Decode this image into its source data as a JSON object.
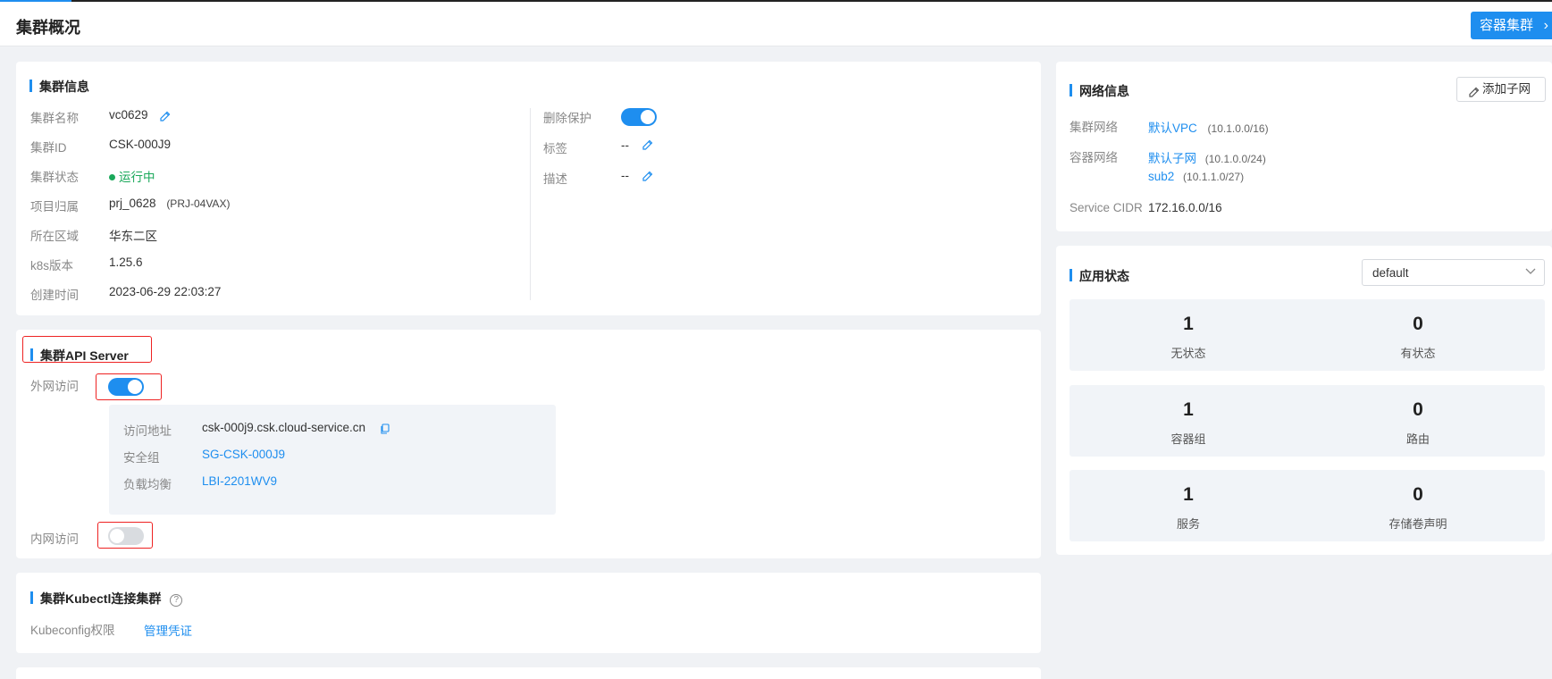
{
  "header": {
    "title": "集群概况",
    "container_cluster_btn": "容器集群",
    "chevron": "›"
  },
  "cluster_info": {
    "title": "集群信息",
    "left": [
      {
        "label": "集群名称",
        "value": "vc0629"
      },
      {
        "label": "集群ID",
        "value": "CSK-000J9"
      },
      {
        "label": "集群状态",
        "value": "运行中"
      },
      {
        "label": "项目归属",
        "value": "prj_0628",
        "extra": "(PRJ-04VAX)"
      },
      {
        "label": "所在区域",
        "value": "华东二区"
      },
      {
        "label": "k8s版本",
        "value": "1.25.6"
      },
      {
        "label": "创建时间",
        "value": "2023-06-29 22:03:27"
      }
    ],
    "right": [
      {
        "label": "删除保护",
        "value": ""
      },
      {
        "label": "标签",
        "value": "--"
      },
      {
        "label": "描述",
        "value": "--"
      }
    ],
    "delete_protection_on": true
  },
  "api_server": {
    "title": "集群API Server",
    "public_label": "外网访问",
    "public_on": true,
    "details": [
      {
        "label": "访问地址",
        "value": "csk-000j9.csk.cloud-service.cn"
      },
      {
        "label": "安全组",
        "value": "SG-CSK-000J9"
      },
      {
        "label": "负载均衡",
        "value": "LBI-2201WV9"
      }
    ],
    "private_label": "内网访问",
    "private_on": false
  },
  "kubectl": {
    "title": "集群Kubectl连接集群",
    "help_icon": "?",
    "kubeconfig_label": "Kubeconfig权限",
    "kubeconfig_link": "管理凭证"
  },
  "network": {
    "title": "网络信息",
    "add_subnet_btn": "添加子网",
    "cluster_net_label": "集群网络",
    "cluster_net_link": "默认VPC",
    "cluster_net_cidr": "(10.1.0.0/16)",
    "container_net_label": "容器网络",
    "container_nets": [
      {
        "name": "默认子网",
        "cidr": "(10.1.0.0/24)"
      },
      {
        "name": "sub2",
        "cidr": "(10.1.1.0/27)"
      }
    ],
    "service_cidr_label": "Service CIDR",
    "service_cidr_value": "172.16.0.0/16"
  },
  "app_status": {
    "title": "应用状态",
    "namespace_selected": "default",
    "stats": [
      {
        "num": "1",
        "label": "无状态"
      },
      {
        "num": "0",
        "label": "有状态"
      },
      {
        "num": "1",
        "label": "容器组"
      },
      {
        "num": "0",
        "label": "路由"
      },
      {
        "num": "1",
        "label": "服务"
      },
      {
        "num": "0",
        "label": "存储卷声明"
      }
    ]
  },
  "colors": {
    "accent": "#1e8eef",
    "running": "#1aa85a",
    "highlight_box": "#ee2222"
  }
}
